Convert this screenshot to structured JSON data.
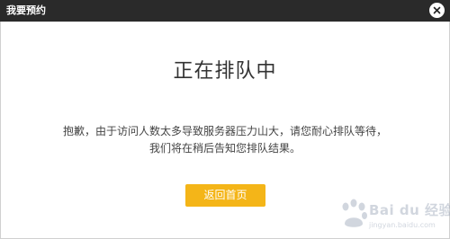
{
  "window": {
    "title": "我要预约"
  },
  "main": {
    "heading": "正在排队中",
    "message_line1": "抱歉，由于访问人数太多导致服务器压力山大，请您耐心排队等待，",
    "message_line2": "我们将在稍后告知您排队结果。",
    "back_button": "返回首页"
  },
  "watermark": {
    "brand": "Bai du 经验",
    "url": "jingyan.baidu.com"
  },
  "colors": {
    "titlebar": "#2a2a2a",
    "button": "#f4b518",
    "heading": "#333333"
  }
}
